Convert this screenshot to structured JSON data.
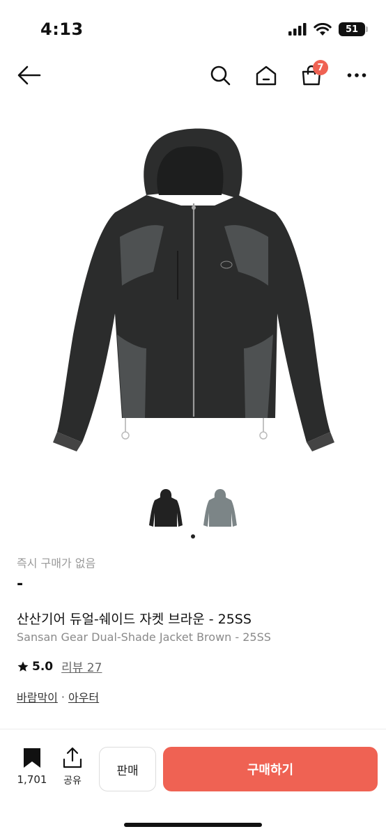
{
  "status_bar": {
    "time": "4:13",
    "battery": "51"
  },
  "nav": {
    "cart_count": "7"
  },
  "icons": [
    "back-arrow-icon",
    "search-icon",
    "home-icon",
    "shopping-bag-icon",
    "more-icon",
    "bookmark-icon",
    "share-icon",
    "star-icon"
  ],
  "product": {
    "instant_purchase_status": "즉시 구매가 없음",
    "price": "-",
    "title_ko": "산산기어 듀얼-쉐이드 자켓 브라운 - 25SS",
    "title_en": "Sansan Gear Dual-Shade Jacket Brown - 25SS",
    "rating": "5.0",
    "review_label": "리뷰 27",
    "categories": [
      "바람막이",
      "아우터"
    ],
    "category_separator": "·"
  },
  "bottom_bar": {
    "bookmark_count": "1,701",
    "share_label": "공유",
    "sell_label": "판매",
    "buy_label": "구매하기"
  },
  "colors": {
    "accent": "#ef6253",
    "jacket": "#2b2c2c",
    "panel": "#4e5152",
    "thumb_grey": "#7c8587"
  }
}
